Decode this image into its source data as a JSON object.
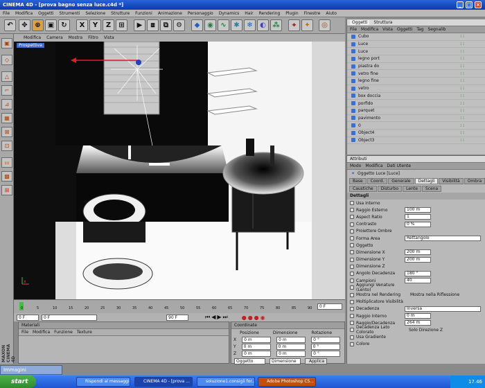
{
  "window": {
    "title": "CINEMA 4D - [prova bagno senza luce.c4d *]"
  },
  "menu": [
    "File",
    "Modifica",
    "Oggetti",
    "Strumenti",
    "Selezione",
    "Strutture",
    "Funzioni",
    "Animazione",
    "Personaggio",
    "Dynamics",
    "Hair",
    "Rendering",
    "Plugin",
    "Finestre",
    "Aiuto"
  ],
  "toolbar": {
    "axes": [
      "X",
      "Y",
      "Z"
    ]
  },
  "viewport": {
    "menu": [
      "Modifica",
      "Camera",
      "Mostra",
      "Filtro",
      "Vista"
    ],
    "label": "Prospettiva"
  },
  "objects": {
    "tabs": [
      "Oggetti",
      "Struttura"
    ],
    "menu": [
      "File",
      "Modifica",
      "Vista",
      "Oggetti",
      "Tag",
      "Segnalib"
    ],
    "items": [
      "Cubo",
      "Luce",
      "Luce",
      "legno port",
      "piastra do",
      "vetro fine",
      "legno fine",
      "vetro",
      "box doccia",
      "porfido",
      "parquet",
      "pavimento",
      "0",
      "Object4",
      "Object3"
    ]
  },
  "attributes": {
    "tab": "Attributi",
    "menu": [
      "Modo",
      "Modifica",
      "Dati Utente"
    ],
    "object_title": "Oggetto Luce [Luce]",
    "tabs_row1": [
      "Base",
      "Coord.",
      "Generale",
      "Dettagli",
      "Visibilità",
      "Ombra"
    ],
    "tabs_row2": [
      "Caustiche",
      "Disturbo",
      "Lente",
      "Scena"
    ],
    "active_tab": "Dettagli",
    "section": "Dettagli",
    "fields": [
      {
        "label": "Usa Interno",
        "value": ""
      },
      {
        "label": "Raggio Esterno",
        "value": "100 m"
      },
      {
        "label": "Aspect Ratio",
        "value": "1"
      },
      {
        "label": "Contrasto",
        "value": "0 %"
      },
      {
        "label": "Proiettore Ombre",
        "value": ""
      },
      {
        "label": "Forma Area",
        "value": "Rettangolo"
      },
      {
        "label": "Oggetto",
        "value": ""
      },
      {
        "label": "Dimensione X",
        "value": "200 m"
      },
      {
        "label": "Dimensione Y",
        "value": "200 m"
      },
      {
        "label": "Dimensione Z",
        "value": ""
      },
      {
        "label": "Angolo Decadenza",
        "value": "180 °"
      },
      {
        "label": "Campioni",
        "value": "40"
      },
      {
        "label": "Aggiungi Venature (Lento)",
        "value": ""
      },
      {
        "label": "Mostra nel Rendering",
        "value": ""
      },
      {
        "label": "Moltiplicatore Visibilità",
        "value": ""
      },
      {
        "label": "Decadenza",
        "value": "Inversa"
      },
      {
        "label": "Raggio Interno",
        "value": "0 m"
      },
      {
        "label": "Raggio/Decadenza",
        "value": "264 m"
      },
      {
        "label": "Decadenza Lato Colorato",
        "value": ""
      },
      {
        "label": "Usa Gradiente",
        "value": ""
      },
      {
        "label": "Colore",
        "value": ""
      }
    ],
    "extra": {
      "mostra_riflessione": "Mostra nella Riflessione",
      "solo_direzione": "Solo Direzione Z"
    }
  },
  "timeline": {
    "ticks": [
      "0",
      "5",
      "10",
      "15",
      "20",
      "25",
      "30",
      "35",
      "40",
      "45",
      "50",
      "55",
      "60",
      "65",
      "70",
      "75",
      "80",
      "85",
      "90"
    ],
    "frame_end": "0 F"
  },
  "transport": {
    "start": "0 F",
    "field2": "0 F",
    "end": "90 F"
  },
  "materials": {
    "title": "Materiali",
    "menu": [
      "File",
      "Modifica",
      "Funzione",
      "Texture"
    ]
  },
  "coords": {
    "title": "Coordinate",
    "headers": [
      "Posizione",
      "Dimensione",
      "Rotazione"
    ],
    "axes": [
      "X",
      "Y",
      "Z"
    ],
    "pos": [
      "0 m",
      "0 m",
      "0 m"
    ],
    "dim": [
      "0 m",
      "0 m",
      "0 m"
    ],
    "rot": [
      "0 °",
      "0 °",
      "0 °"
    ],
    "mode1": "Oggetto",
    "mode2": "Dimensione",
    "apply": "Applica"
  },
  "immagini": "Immagini",
  "taskbar": {
    "start": "start",
    "tasks": [
      "Rispondi al messaggio...",
      "CINEMA 4D - [prova ...",
      "soluzione1.consigli for...",
      "Adobe Photoshop CS..."
    ],
    "clock": "17.46"
  },
  "brand": "MAXON CINEMA 4D"
}
